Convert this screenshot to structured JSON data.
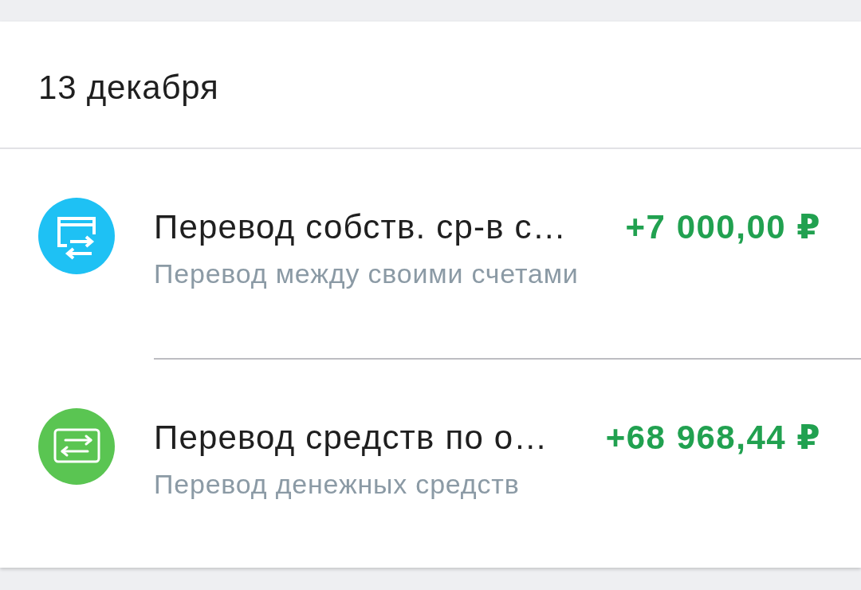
{
  "date_header": "13 декабря",
  "transactions": [
    {
      "kind": "own_accounts",
      "color": "#1ec1f4",
      "title": "Перевод собств. ср-в с…",
      "amount": "+7 000,00 ₽",
      "subtitle": "Перевод между своими счетами"
    },
    {
      "kind": "money_transfer",
      "color": "#5ac552",
      "title": "Перевод средств по о…",
      "amount": "+68 968,44 ₽",
      "subtitle": "Перевод денежных средств"
    }
  ]
}
